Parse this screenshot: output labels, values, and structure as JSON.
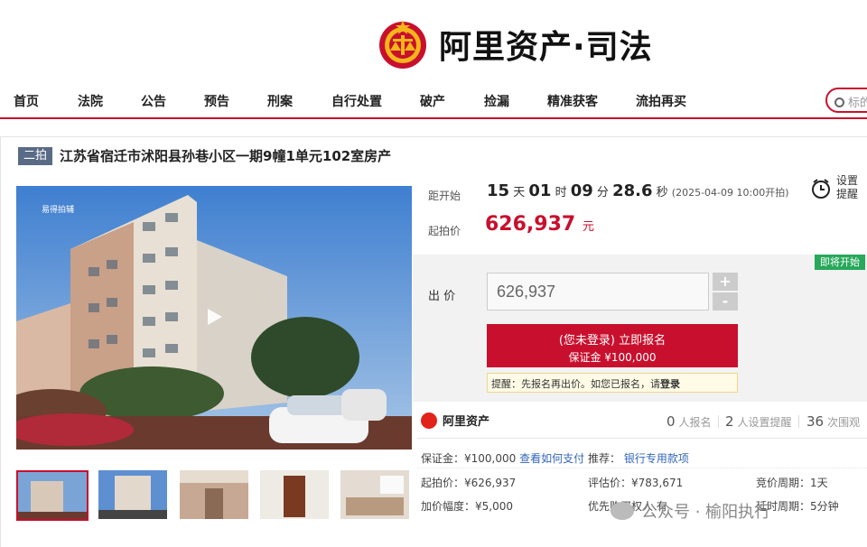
{
  "brand": {
    "name": "阿里资产·司法"
  },
  "nav": {
    "items": [
      "首页",
      "法院",
      "公告",
      "预告",
      "刑案",
      "自行处置",
      "破产",
      "捡漏",
      "精准获客",
      "流拍再买"
    ],
    "search_placeholder": "标的"
  },
  "item": {
    "round_badge": "二拍",
    "title": "江苏省宿迁市沭阳县孙巷小区一期9幢1单元102室房产"
  },
  "countdown": {
    "label": "距开始",
    "days": "15",
    "days_unit": "天",
    "hours": "01",
    "hours_unit": "时",
    "minutes": "09",
    "minutes_unit": "分",
    "seconds": "28.6",
    "seconds_unit": "秒",
    "start_note": "(2025-04-09 10:00开拍)"
  },
  "reminder": {
    "line1": "设置",
    "line2": "提醒"
  },
  "start_price": {
    "label": "起拍价",
    "value": "626,937",
    "unit": "元"
  },
  "bid": {
    "status_tag": "即将开始",
    "label": "出 价",
    "input_value": "626,937",
    "plus": "+",
    "minus": "-",
    "register_line1": "(您未登录) 立即报名",
    "register_line2": "保证金 ¥100,000",
    "tip_prefix": "提醒：先报名再出价。如您已报名，请",
    "tip_login": "登录"
  },
  "platform": {
    "name": "阿里资产"
  },
  "stats": [
    {
      "value": "0",
      "label": "人报名"
    },
    {
      "value": "2",
      "label": "人设置提醒"
    },
    {
      "value": "36",
      "label": "次围观"
    }
  ],
  "details": {
    "deposit_label": "保证金：¥100,000",
    "how_to_pay": "查看如何支付",
    "recommend_label": "推荐：",
    "bank_loan": "银行专用款项",
    "start_price_line": "起拍价：¥626,937",
    "appraisal_line": "评估价：¥783,671",
    "cycle_line": "竞价周期：1天",
    "increment_line": "加价幅度：¥5,000",
    "priority_line": "优先购买权人",
    "priority_val": "有",
    "extension_line": "延时周期：5分钟"
  },
  "watermark": {
    "text": "公众号 · 榆阳执行"
  },
  "photo": {
    "watermark": "易得拍辅"
  },
  "colors": {
    "accent": "#c8102e",
    "badge": "#5a6b86",
    "green_tag": "#27a85a",
    "link": "#3366bb"
  }
}
